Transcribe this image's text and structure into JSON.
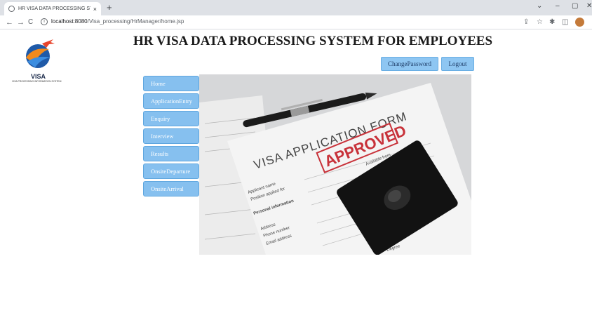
{
  "browser": {
    "tab_title": "HR VISA DATA PROCESSING SYS",
    "tab_close": "×",
    "new_tab": "+",
    "window_controls": [
      "⌄",
      "–",
      "▢",
      "✕"
    ],
    "nav": {
      "back": "←",
      "forward": "→",
      "reload": "C"
    },
    "url_host": "localhost:8080",
    "url_path": "/Visa_processing/HrManager/home.jsp"
  },
  "logo": {
    "text": "VISA",
    "subtext": "VISA PROCESSING INFORMATION SYSTEM"
  },
  "page": {
    "title": "HR VISA DATA PROCESSING SYSTEM FOR EMPLOYEES",
    "change_password": "ChangePassword",
    "logout": "Logout"
  },
  "sidebar": {
    "items": [
      {
        "label": "Home"
      },
      {
        "label": "ApplicationEntry"
      },
      {
        "label": "Enquiry"
      },
      {
        "label": "Interview"
      },
      {
        "label": "Results"
      },
      {
        "label": "OnsiteDeparture"
      },
      {
        "label": "OnsiteArrival"
      }
    ]
  },
  "hero": {
    "form_title": "VISA APPLICATION FORM",
    "stamp": "APPROVED",
    "stamp_sub": "Available from",
    "fields": [
      "Applicant name",
      "Position applied for",
      "Personal information",
      "Address",
      "Phone number",
      "Email address",
      "Degree"
    ]
  },
  "colors": {
    "button_bg": "#86c0ef",
    "stamp_red": "#c8323a"
  }
}
